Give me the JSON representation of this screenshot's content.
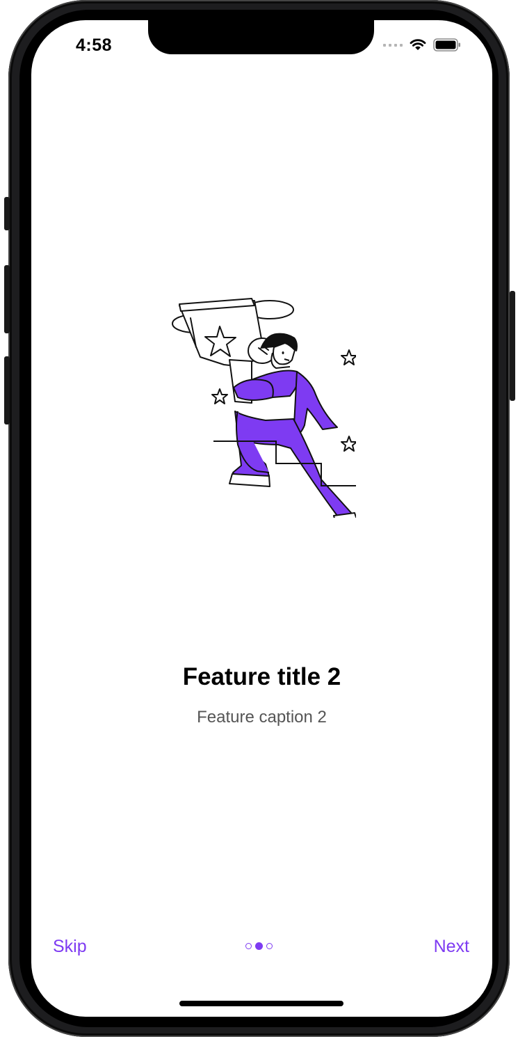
{
  "status_bar": {
    "time": "4:58",
    "icons": [
      "cellular-signal-icon",
      "wifi-icon",
      "battery-icon"
    ]
  },
  "onboarding": {
    "illustration": "person-carrying-trophy-up-stairs",
    "title": "Feature title 2",
    "caption": "Feature caption 2"
  },
  "footer": {
    "skip_label": "Skip",
    "next_label": "Next",
    "page_count": 3,
    "current_page": 2
  },
  "colors": {
    "accent": "#7e3bf2",
    "title": "#000000",
    "caption": "#555555",
    "background": "#ffffff"
  }
}
